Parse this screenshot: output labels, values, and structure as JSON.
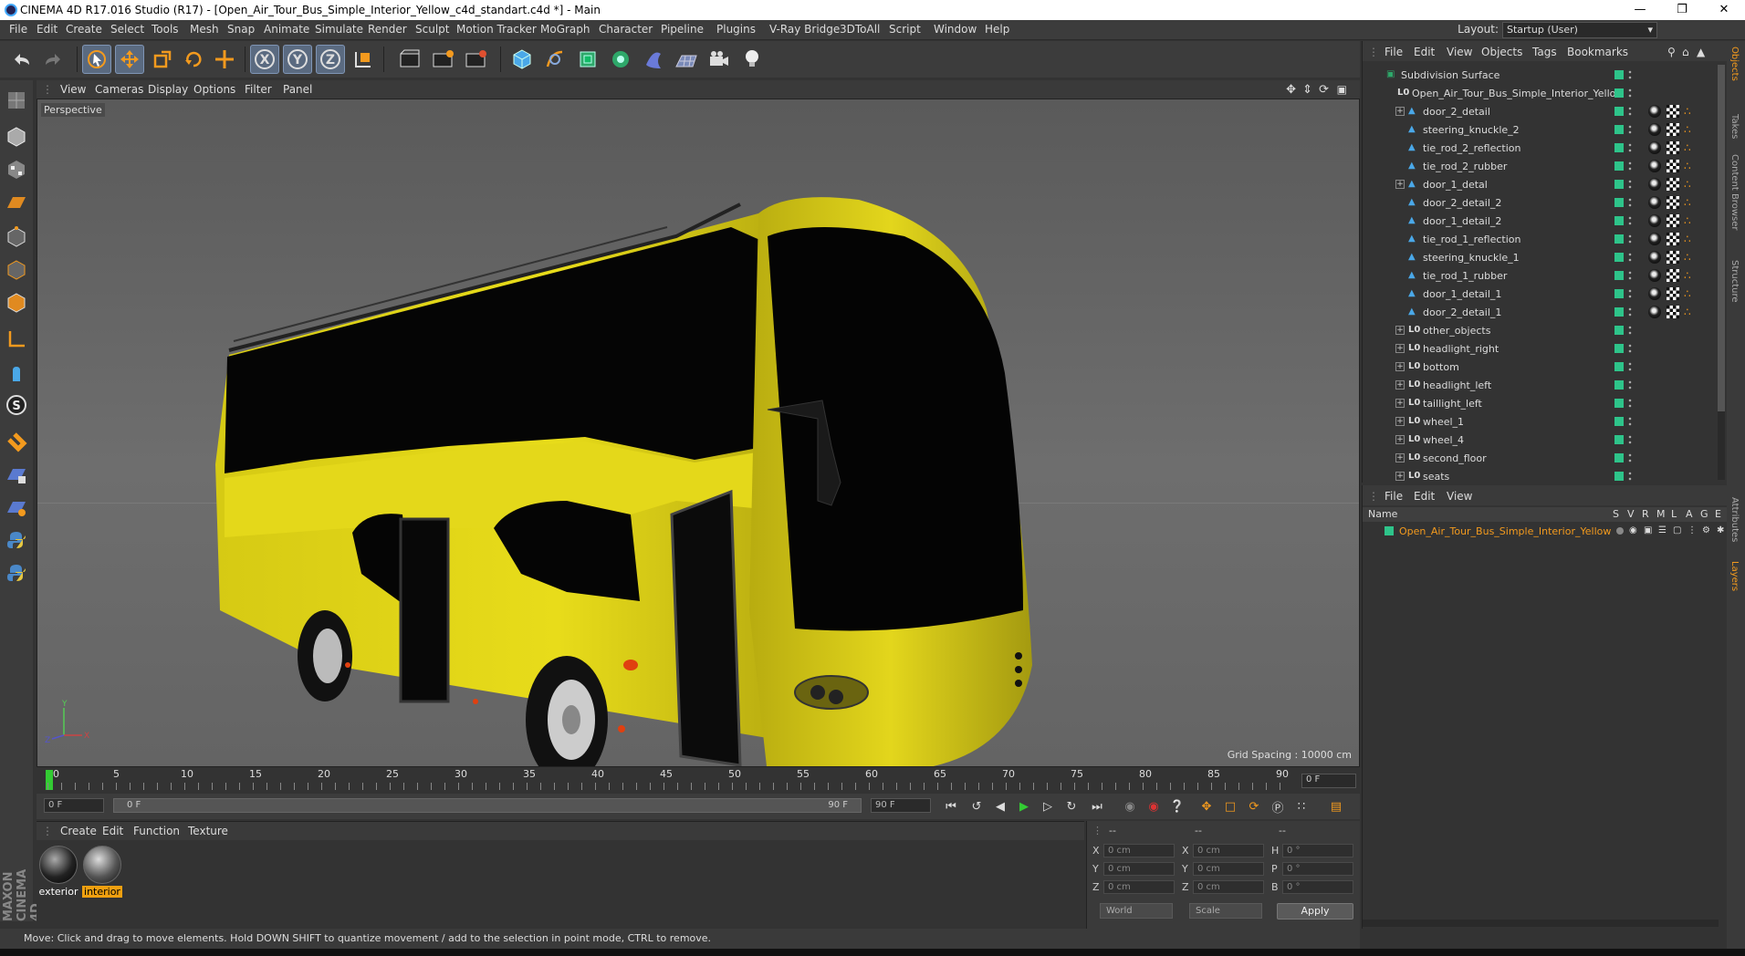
{
  "window": {
    "title": "CINEMA 4D R17.016 Studio (R17) - [Open_Air_Tour_Bus_Simple_Interior_Yellow_c4d_standart.c4d *] - Main"
  },
  "menubar": {
    "items": [
      "File",
      "Edit",
      "Create",
      "Select",
      "Tools",
      "Mesh",
      "Snap",
      "Animate",
      "Simulate",
      "Render",
      "Sculpt",
      "Motion Tracker",
      "MoGraph",
      "Character",
      "Pipeline",
      "Plugins",
      "V-Ray Bridge",
      "3DToAll",
      "Script",
      "Window",
      "Help"
    ],
    "layout_label": "Layout:",
    "layout_value": "Startup (User)"
  },
  "toolbar": {
    "icons": [
      "undo-icon",
      "redo-icon",
      "select-arrow-icon",
      "move-icon",
      "scale-icon",
      "rotate-icon",
      "live-select-icon",
      "x-axis-icon",
      "y-axis-icon",
      "z-axis-icon",
      "coordinate-system-icon",
      "render-view-icon",
      "render-picture-viewer-icon",
      "render-settings-icon",
      "cube-icon",
      "pen-icon",
      "subdivision-icon",
      "cloner-icon",
      "deformer-icon",
      "floor-icon",
      "camera-icon",
      "light-icon"
    ]
  },
  "viewport": {
    "menu": [
      "View",
      "Cameras",
      "Display",
      "Options",
      "Filter",
      "Panel"
    ],
    "label": "Perspective",
    "grid_spacing": "Grid Spacing : 10000 cm"
  },
  "timeline": {
    "ticks": [
      "0",
      "5",
      "10",
      "15",
      "20",
      "25",
      "30",
      "35",
      "40",
      "45",
      "50",
      "55",
      "60",
      "65",
      "70",
      "75",
      "80",
      "85",
      "90"
    ],
    "current_frame": "0 F",
    "start_field": "0 F",
    "range_start": "0 F",
    "range_end": "90 F",
    "end_field": "90 F"
  },
  "materials": {
    "menu": [
      "Create",
      "Edit",
      "Function",
      "Texture"
    ],
    "items": [
      {
        "label": "exterior",
        "active": false
      },
      {
        "label": "interior",
        "active": true
      }
    ]
  },
  "coords": {
    "headers": [
      "--",
      "--",
      "--"
    ],
    "rows": [
      {
        "l1": "X",
        "v1": "0 cm",
        "l2": "X",
        "v2": "0 cm",
        "l3": "H",
        "v3": "0 °"
      },
      {
        "l1": "Y",
        "v1": "0 cm",
        "l2": "Y",
        "v2": "0 cm",
        "l3": "P",
        "v3": "0 °"
      },
      {
        "l1": "Z",
        "v1": "0 cm",
        "l2": "Z",
        "v2": "0 cm",
        "l3": "B",
        "v3": "0 °"
      }
    ],
    "mode": "World",
    "type": "Scale",
    "apply": "Apply"
  },
  "status": {
    "text": "Move: Click and drag to move elements. Hold DOWN SHIFT to quantize movement / add to the selection in point mode, CTRL to remove."
  },
  "object_manager": {
    "menu": [
      "File",
      "Edit",
      "View",
      "Objects",
      "Tags",
      "Bookmarks"
    ],
    "objects": [
      {
        "name": "Subdivision Surface",
        "level": 0,
        "plus": false,
        "type": "subdiv",
        "tags": false
      },
      {
        "name": "Open_Air_Tour_Bus_Simple_Interior_Yellow",
        "level": 1,
        "plus": false,
        "type": "null",
        "tags": false
      },
      {
        "name": "door_2_detail",
        "level": 2,
        "plus": true,
        "type": "poly",
        "tags": true
      },
      {
        "name": "steering_knuckle_2",
        "level": 2,
        "plus": false,
        "type": "poly",
        "tags": true
      },
      {
        "name": "tie_rod_2_reflection",
        "level": 2,
        "plus": false,
        "type": "poly",
        "tags": true
      },
      {
        "name": "tie_rod_2_rubber",
        "level": 2,
        "plus": false,
        "type": "poly",
        "tags": true
      },
      {
        "name": "door_1_detal",
        "level": 2,
        "plus": true,
        "type": "poly",
        "tags": true
      },
      {
        "name": "door_2_detail_2",
        "level": 2,
        "plus": false,
        "type": "poly",
        "tags": true
      },
      {
        "name": "door_1_detail_2",
        "level": 2,
        "plus": false,
        "type": "poly",
        "tags": true
      },
      {
        "name": "tie_rod_1_reflection",
        "level": 2,
        "plus": false,
        "type": "poly",
        "tags": true
      },
      {
        "name": "steering_knuckle_1",
        "level": 2,
        "plus": false,
        "type": "poly",
        "tags": true
      },
      {
        "name": "tie_rod_1_rubber",
        "level": 2,
        "plus": false,
        "type": "poly",
        "tags": true
      },
      {
        "name": "door_1_detail_1",
        "level": 2,
        "plus": false,
        "type": "poly",
        "tags": true
      },
      {
        "name": "door_2_detail_1",
        "level": 2,
        "plus": false,
        "type": "poly",
        "tags": true
      },
      {
        "name": "other_objects",
        "level": 2,
        "plus": true,
        "type": "null",
        "tags": false
      },
      {
        "name": "headlight_right",
        "level": 2,
        "plus": true,
        "type": "null",
        "tags": false
      },
      {
        "name": "bottom",
        "level": 2,
        "plus": true,
        "type": "null",
        "tags": false
      },
      {
        "name": "headlight_left",
        "level": 2,
        "plus": true,
        "type": "null",
        "tags": false
      },
      {
        "name": "taillight_left",
        "level": 2,
        "plus": true,
        "type": "null",
        "tags": false
      },
      {
        "name": "wheel_1",
        "level": 2,
        "plus": true,
        "type": "null",
        "tags": false
      },
      {
        "name": "wheel_4",
        "level": 2,
        "plus": true,
        "type": "null",
        "tags": false
      },
      {
        "name": "second_floor",
        "level": 2,
        "plus": true,
        "type": "null",
        "tags": false
      },
      {
        "name": "seats",
        "level": 2,
        "plus": true,
        "type": "null",
        "tags": false
      }
    ]
  },
  "layer_manager": {
    "menu": [
      "File",
      "Edit",
      "View"
    ],
    "columns": [
      "Name",
      "S",
      "V",
      "R",
      "M",
      "L",
      "A",
      "G",
      "E"
    ],
    "layers": [
      {
        "name": "Open_Air_Tour_Bus_Simple_Interior_Yellow",
        "color": "#2ec48a"
      }
    ]
  },
  "right_tabs": [
    "Objects",
    "Takes",
    "Content Browser",
    "Structure",
    "Attributes",
    "Layers"
  ],
  "colors": {
    "accent": "#f0a010",
    "layer_green": "#2ec48a",
    "bus_yellow": "#e8d818"
  }
}
